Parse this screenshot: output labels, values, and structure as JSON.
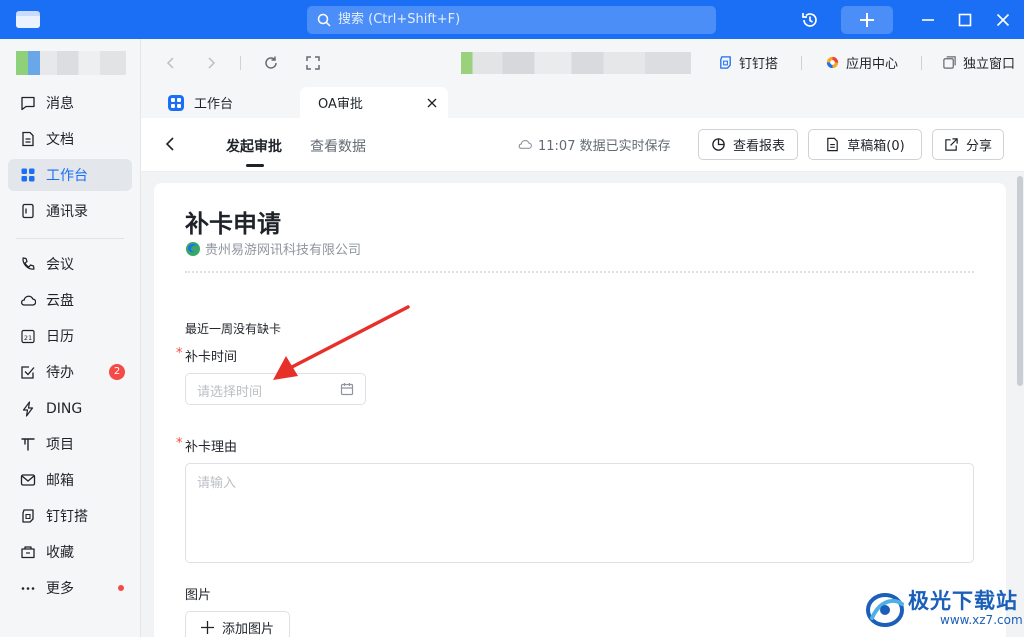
{
  "titlebar": {
    "search_placeholder": "搜索 (Ctrl+Shift+F)"
  },
  "sidebar": {
    "items": [
      {
        "label": "消息",
        "icon": "message-icon"
      },
      {
        "label": "文档",
        "icon": "document-icon"
      },
      {
        "label": "工作台",
        "icon": "workbench-icon",
        "active": true
      },
      {
        "label": "通讯录",
        "icon": "contacts-icon"
      },
      {
        "label": "会议",
        "icon": "meeting-icon"
      },
      {
        "label": "云盘",
        "icon": "cloud-drive-icon"
      },
      {
        "label": "日历",
        "icon": "calendar-icon",
        "icon_text": "21"
      },
      {
        "label": "待办",
        "icon": "todo-icon",
        "badge": "2"
      },
      {
        "label": "DING",
        "icon": "ding-icon"
      },
      {
        "label": "项目",
        "icon": "project-icon"
      },
      {
        "label": "邮箱",
        "icon": "mail-icon"
      },
      {
        "label": "钉钉搭",
        "icon": "dingda-icon"
      },
      {
        "label": "收藏",
        "icon": "favorites-icon"
      },
      {
        "label": "更多",
        "icon": "more-icon",
        "dot": true
      }
    ]
  },
  "browser": {
    "links": {
      "dingda": "钉钉搭",
      "app_center": "应用中心",
      "standalone": "独立窗口"
    }
  },
  "tabs": [
    {
      "label": "工作台"
    },
    {
      "label": "OA审批",
      "active": true
    }
  ],
  "header": {
    "tabs": [
      "发起审批",
      "查看数据"
    ],
    "save_status": "11:07 数据已实时保存",
    "buttons": {
      "report": "查看报表",
      "drafts": "草稿箱(0)",
      "share": "分享"
    }
  },
  "form": {
    "title": "补卡申请",
    "company": "贵州易游网讯科技有限公司",
    "hint": "最近一周没有缺卡",
    "required_mark": "*",
    "time_label": "补卡时间",
    "time_placeholder": "请选择时间",
    "reason_label": "补卡理由",
    "reason_placeholder": "请输入",
    "image_label": "图片",
    "add_image": "添加图片"
  },
  "watermark": {
    "title": "极光下载站",
    "url": "www.xz7.com"
  },
  "colors": {
    "accent": "#1a6ff5",
    "badge": "#f54a45",
    "arrow": "#e8302a"
  }
}
